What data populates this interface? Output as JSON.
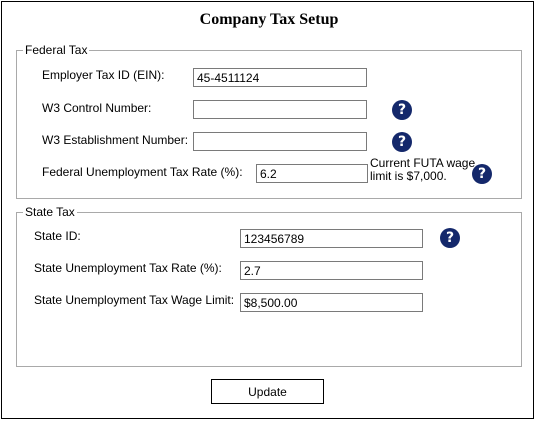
{
  "title": "Company Tax Setup",
  "federal": {
    "legend": "Federal Tax",
    "ein_label": "Employer Tax ID (EIN):",
    "ein_value": "45-4511124",
    "w3_control_label": "W3 Control Number:",
    "w3_control_value": "",
    "w3_establishment_label": "W3 Establishment Number:",
    "w3_establishment_value": "",
    "futa_rate_label": "Federal Unemployment Tax Rate  (%):",
    "futa_rate_value": "6.2",
    "futa_note": "Current FUTA wage limit is $7,000.",
    "help_glyph": "?"
  },
  "state": {
    "legend": "State Tax",
    "state_id_label": "State ID:",
    "state_id_value": "123456789",
    "suta_rate_label": "State Unemployment Tax Rate  (%):",
    "suta_rate_value": "2.7",
    "suta_limit_label": "State Unemployment Tax Wage Limit:",
    "suta_limit_value": "$8,500.00",
    "help_glyph": "?"
  },
  "update_label": "Update",
  "colors": {
    "help_icon_bg": "#14286b",
    "border": "#a9a9a9"
  }
}
